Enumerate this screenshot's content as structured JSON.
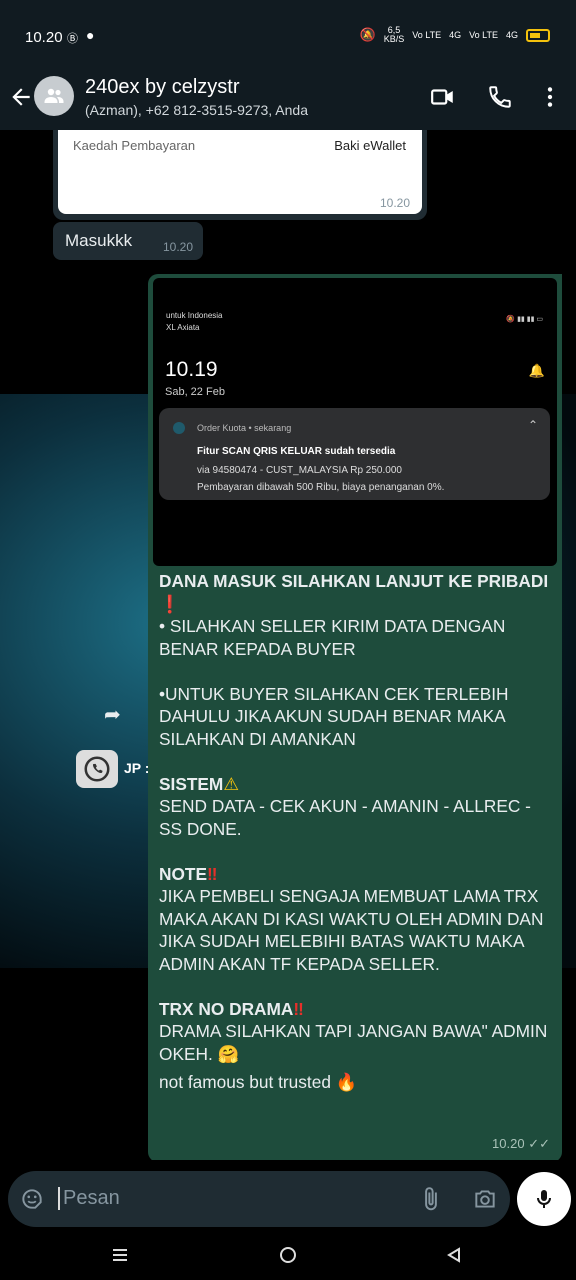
{
  "status_bar": {
    "time": "10.20",
    "speed_top": "6,5",
    "speed_unit": "KB/S",
    "net1": "Vo LTE",
    "net2": "4G",
    "net3": "Vo LTE",
    "net4": "4G"
  },
  "header": {
    "title": "240ex by celzystr",
    "subtitle": "(Azman), +62 812-3515-9273, Anda"
  },
  "messages": {
    "payment_card": {
      "label": "Kaedah Pembayaran",
      "value": "Baki eWallet",
      "time": "10.20"
    },
    "incoming": {
      "text": "Masukkk",
      "time": "10.20"
    },
    "screenshot": {
      "carrier_line1": "untuk Indonesia",
      "carrier_line2": "XL Axiata",
      "clock": "10.19",
      "date": "Sab, 22 Feb",
      "notif_app": "Order Kuota • sekarang",
      "notif_title": "Fitur SCAN QRIS KELUAR sudah tersedia",
      "notif_line1": "via 94580474 - CUST_MALAYSIA Rp 250.000",
      "notif_line2": "Pembayaran dibawah 500 Ribu, biaya penanganan 0%."
    },
    "outgoing": {
      "line_dana": "DANA MASUK SILAHKAN LANJUT KE PRIBADI",
      "bullet1": "• SILAHKAN SELLER KIRIM DATA DENGAN BENAR KEPADA BUYER",
      "bullet2": "•UNTUK BUYER SILAHKAN CEK TERLEBIH DAHULU JIKA AKUN SUDAH BENAR MAKA SILAHKAN DI AMANKAN",
      "sistem_head": "SISTEM",
      "sistem_body": "SEND DATA - CEK AKUN - AMANIN - ALLREC - SS DONE.",
      "note_head": "NOTE",
      "note_body": "JIKA PEMBELI SENGAJA MEMBUAT LAMA TRX MAKA AKAN DI KASI WAKTU OLEH ADMIN DAN JIKA SUDAH MELEBIHI BATAS WAKTU MAKA ADMIN AKAN TF KEPADA SELLER.",
      "trx_head": "TRX NO DRAMA",
      "trx_body": "DRAMA SILAHKAN TAPI JANGAN BAWA\" ADMIN OKEH.",
      "footer": "not famous but trusted",
      "time": "10.20"
    }
  },
  "wallpaper": {
    "label": "JP :"
  },
  "input": {
    "placeholder": "Pesan"
  },
  "colors": {
    "outgoing_bubble": "#1e4c3c",
    "incoming_bubble": "#202c33",
    "header": "#111b21",
    "accent_red": "#e5302a"
  }
}
